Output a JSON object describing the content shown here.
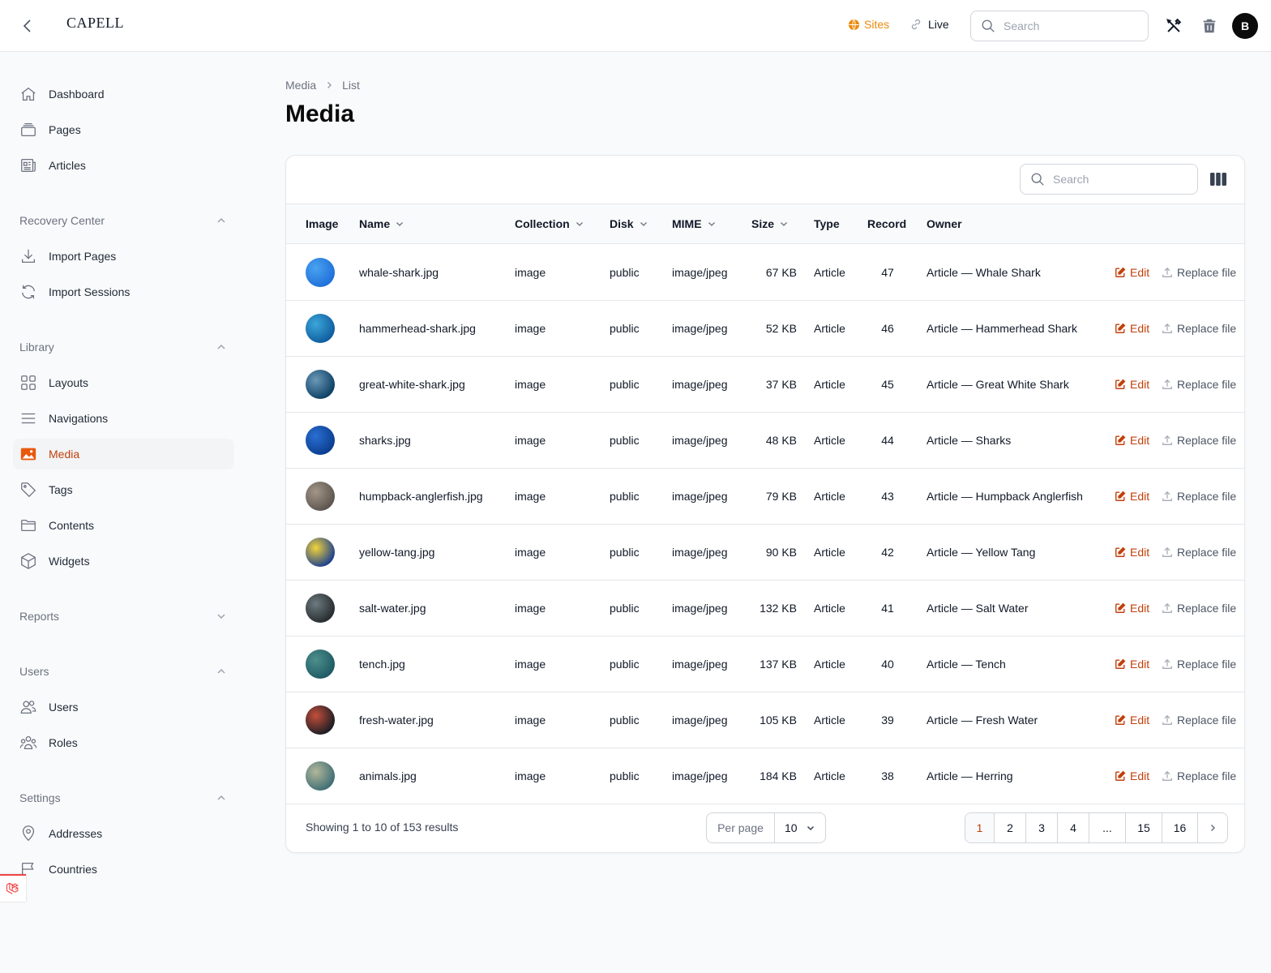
{
  "header": {
    "logo": "CAPELL",
    "sites_label": "Sites",
    "live_label": "Live",
    "search_placeholder": "Search",
    "avatar_initial": "B",
    "accent_color": "#ea8a0b"
  },
  "sidebar": {
    "top_items": [
      {
        "label": "Dashboard",
        "icon": "home-icon"
      },
      {
        "label": "Pages",
        "icon": "pages-icon"
      },
      {
        "label": "Articles",
        "icon": "newspaper-icon"
      }
    ],
    "groups": [
      {
        "label": "Recovery Center",
        "expanded": true,
        "items": [
          {
            "label": "Import Pages",
            "icon": "download-icon"
          },
          {
            "label": "Import Sessions",
            "icon": "refresh-icon"
          }
        ]
      },
      {
        "label": "Library",
        "expanded": true,
        "items": [
          {
            "label": "Layouts",
            "icon": "layout-grid-icon"
          },
          {
            "label": "Navigations",
            "icon": "menu-lines-icon"
          },
          {
            "label": "Media",
            "icon": "photo-icon",
            "active": true
          },
          {
            "label": "Tags",
            "icon": "tag-icon"
          },
          {
            "label": "Contents",
            "icon": "folder-icon"
          },
          {
            "label": "Widgets",
            "icon": "cube-icon"
          }
        ]
      },
      {
        "label": "Reports",
        "expanded": false,
        "items": []
      },
      {
        "label": "Users",
        "expanded": true,
        "items": [
          {
            "label": "Users",
            "icon": "users-icon"
          },
          {
            "label": "Roles",
            "icon": "user-group-icon"
          }
        ]
      },
      {
        "label": "Settings",
        "expanded": true,
        "items": [
          {
            "label": "Addresses",
            "icon": "map-pin-icon"
          },
          {
            "label": "Countries",
            "icon": "flag-icon"
          }
        ]
      }
    ]
  },
  "breadcrumb": [
    "Media",
    "List"
  ],
  "page_title": "Media",
  "table": {
    "search_placeholder": "Search",
    "columns": [
      "Image",
      "Name",
      "Collection",
      "Disk",
      "MIME",
      "Size",
      "Type",
      "Record",
      "Owner"
    ],
    "sortable": [
      false,
      true,
      true,
      true,
      true,
      true,
      false,
      false,
      false
    ],
    "edit_label": "Edit",
    "replace_label": "Replace file",
    "rows": [
      {
        "name": "whale-shark.jpg",
        "collection": "image",
        "disk": "public",
        "mime": "image/jpeg",
        "size": "67 KB",
        "type": "Article",
        "record": "47",
        "owner": "Article — Whale Shark",
        "thumb": [
          "#1e6fd9",
          "#4aa3f0"
        ]
      },
      {
        "name": "hammerhead-shark.jpg",
        "collection": "image",
        "disk": "public",
        "mime": "image/jpeg",
        "size": "52 KB",
        "type": "Article",
        "record": "46",
        "owner": "Article — Hammerhead Shark",
        "thumb": [
          "#0f5c9e",
          "#3ba6d9"
        ]
      },
      {
        "name": "great-white-shark.jpg",
        "collection": "image",
        "disk": "public",
        "mime": "image/jpeg",
        "size": "37 KB",
        "type": "Article",
        "record": "45",
        "owner": "Article — Great White Shark",
        "thumb": [
          "#0c3f63",
          "#6b98b8"
        ]
      },
      {
        "name": "sharks.jpg",
        "collection": "image",
        "disk": "public",
        "mime": "image/jpeg",
        "size": "48 KB",
        "type": "Article",
        "record": "44",
        "owner": "Article — Sharks",
        "thumb": [
          "#0a3d8f",
          "#2a6fd1"
        ]
      },
      {
        "name": "humpback-anglerfish.jpg",
        "collection": "image",
        "disk": "public",
        "mime": "image/jpeg",
        "size": "79 KB",
        "type": "Article",
        "record": "43",
        "owner": "Article — Humpback Anglerfish",
        "thumb": [
          "#5b544d",
          "#a39688"
        ]
      },
      {
        "name": "yellow-tang.jpg",
        "collection": "image",
        "disk": "public",
        "mime": "image/jpeg",
        "size": "90 KB",
        "type": "Article",
        "record": "42",
        "owner": "Article — Yellow Tang",
        "thumb": [
          "#1b3f8f",
          "#f2d43a"
        ]
      },
      {
        "name": "salt-water.jpg",
        "collection": "image",
        "disk": "public",
        "mime": "image/jpeg",
        "size": "132 KB",
        "type": "Article",
        "record": "41",
        "owner": "Article — Salt Water",
        "thumb": [
          "#262b2e",
          "#6c7a7f"
        ]
      },
      {
        "name": "tench.jpg",
        "collection": "image",
        "disk": "public",
        "mime": "image/jpeg",
        "size": "137 KB",
        "type": "Article",
        "record": "40",
        "owner": "Article — Tench",
        "thumb": [
          "#1d5a63",
          "#4e8f8c"
        ]
      },
      {
        "name": "fresh-water.jpg",
        "collection": "image",
        "disk": "public",
        "mime": "image/jpeg",
        "size": "105 KB",
        "type": "Article",
        "record": "39",
        "owner": "Article — Fresh Water",
        "thumb": [
          "#1a1c24",
          "#c44f3b"
        ]
      },
      {
        "name": "animals.jpg",
        "collection": "image",
        "disk": "public",
        "mime": "image/jpeg",
        "size": "184 KB",
        "type": "Article",
        "record": "38",
        "owner": "Article — Herring",
        "thumb": [
          "#3e6d74",
          "#b2b79a"
        ]
      }
    ]
  },
  "footer": {
    "showing": "Showing 1 to 10 of 153 results",
    "per_page_label": "Per page",
    "per_page_value": "10",
    "pages": [
      "1",
      "2",
      "3",
      "4",
      "...",
      "15",
      "16"
    ],
    "current_page": "1"
  }
}
